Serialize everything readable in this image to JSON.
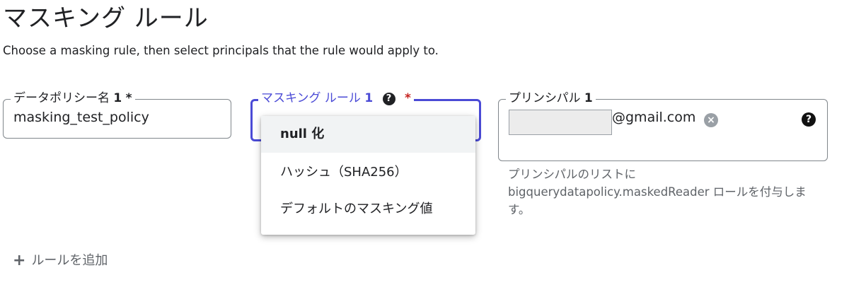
{
  "title": "マスキング ルール",
  "description": "Choose a masking rule, then select principals that the rule would apply to.",
  "policy_field": {
    "label": "データポリシー名",
    "number": "1",
    "required": "*",
    "value": "masking_test_policy"
  },
  "rule_field": {
    "label": "マスキング ルール",
    "number": "1",
    "required": "*",
    "help_icon": "help-icon"
  },
  "rule_options": [
    {
      "label": "null 化",
      "selected": true
    },
    {
      "label": "ハッシュ（SHA256）",
      "selected": false
    },
    {
      "label": "デフォルトのマスキング値",
      "selected": false
    }
  ],
  "principal_field": {
    "label": "プリンシパル",
    "number": "1",
    "chip_text": "@gmail.com",
    "hint": "プリンシパルのリストに bigquerydatapolicy.maskedReader ロールを付与します。"
  },
  "add_rule": {
    "label": "ルールを追加",
    "icon": "plus-icon"
  }
}
